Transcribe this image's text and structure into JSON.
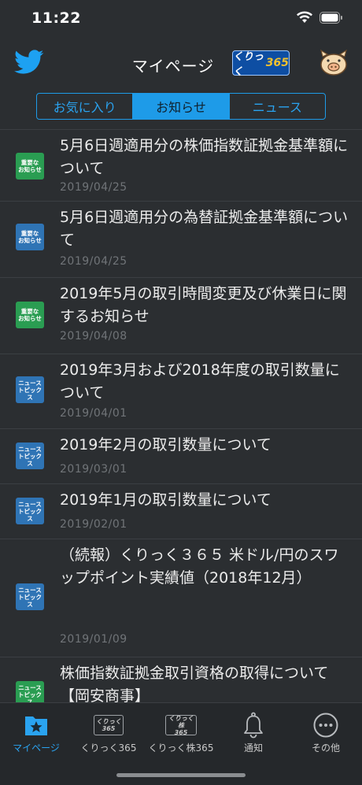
{
  "status_bar": {
    "time": "11:22"
  },
  "header": {
    "title": "マイページ",
    "badge_text": "くりっく",
    "badge_number": "365"
  },
  "segments": [
    {
      "label": "お気に入り",
      "active": false
    },
    {
      "label": "お知らせ",
      "active": true
    },
    {
      "label": "ニュース",
      "active": false
    }
  ],
  "notices": [
    {
      "icon_type": "重要なお知らせ",
      "icon_line1": "重要な",
      "icon_line2": "お知らせ",
      "color": "#2a9d52",
      "title": "5月6日週適用分の株価指数証拠金基準額について",
      "date": "2019/04/25"
    },
    {
      "icon_type": "重要なお知らせ",
      "icon_line1": "重要な",
      "icon_line2": "お知らせ",
      "color": "#2f74b5",
      "title": "5月6日週適用分の為替証拠金基準額について",
      "date": "2019/04/25"
    },
    {
      "icon_type": "重要なお知らせ",
      "icon_line1": "重要な",
      "icon_line2": "お知らせ",
      "color": "#2a9d52",
      "title": "2019年5月の取引時間変更及び休業日に関するお知らせ",
      "date": "2019/04/08"
    },
    {
      "icon_type": "ニュース&トピックス",
      "icon_line1": "ニュース",
      "icon_line2": "トピックス",
      "color": "#2f74b5",
      "title": "2019年3月および2018年度の取引数量について",
      "date": "2019/04/01"
    },
    {
      "icon_type": "ニュース&トピックス",
      "icon_line1": "ニュース",
      "icon_line2": "トピックス",
      "color": "#2f74b5",
      "title": "2019年2月の取引数量について",
      "date": "2019/03/01"
    },
    {
      "icon_type": "ニュース&トピックス",
      "icon_line1": "ニュース",
      "icon_line2": "トピックス",
      "color": "#2f74b5",
      "title": "2019年1月の取引数量について",
      "date": "2019/02/01"
    },
    {
      "icon_type": "ニュース&トピックス",
      "icon_line1": "ニュース",
      "icon_line2": "トピックス",
      "color": "#2f74b5",
      "title": "（続報）くりっく３６５ 米ドル/円のスワップポイント実績値（2018年12月）",
      "date": "2019/01/09"
    },
    {
      "icon_type": "ニュース&トピックス",
      "icon_line1": "ニュース",
      "icon_line2": "トピックス",
      "color": "#2a9d52",
      "title": "株価指数証拠金取引資格の取得について【岡安商事】",
      "date": ""
    }
  ],
  "tabbar": {
    "tabs": [
      {
        "label": "マイページ",
        "icon": "mypage-star-icon",
        "active": true
      },
      {
        "label": "くりっく365",
        "icon": "click365-logo-icon",
        "active": false,
        "logo_top": "くりっく",
        "logo_bottom": "365"
      },
      {
        "label": "くりっく株365",
        "icon": "click-kabu365-logo-icon",
        "active": false,
        "logo_top": "くりっく株",
        "logo_bottom": "365"
      },
      {
        "label": "通知",
        "icon": "bell-icon",
        "active": false
      },
      {
        "label": "その他",
        "icon": "more-icon",
        "active": false
      }
    ]
  },
  "colors": {
    "accent": "#1e9be8",
    "background": "#2b2e31",
    "green_badge": "#2a9d52",
    "blue_badge": "#2f74b5"
  }
}
